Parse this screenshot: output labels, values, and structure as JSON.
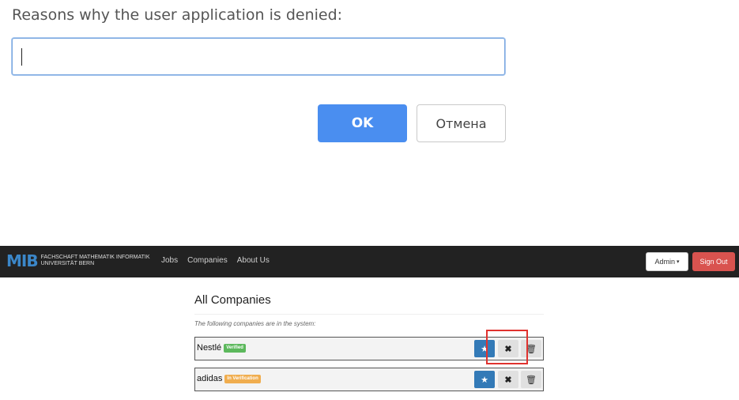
{
  "prompt": {
    "message": "Reasons why the user application is denied:",
    "input_value": "",
    "ok_label": "OK",
    "cancel_label": "Отмена"
  },
  "navbar": {
    "logo_mark": "MIB",
    "logo_line1": "FACHSCHAFT MATHEMATIK INFORMATIK",
    "logo_line2": "UNIVERSITÄT BERN",
    "links": [
      "Jobs",
      "Companies",
      "About Us"
    ],
    "admin_label": "Admin",
    "signout_label": "Sign Out"
  },
  "main": {
    "title": "All Companies",
    "subtitle": "The following companies are in the system:",
    "companies": [
      {
        "name": "Nestlé",
        "status": "Verified"
      },
      {
        "name": "adidas",
        "status": "In Verification"
      }
    ]
  },
  "icons": {
    "star": "★",
    "remove": "✖",
    "trash": "🗑"
  },
  "colors": {
    "ok_button": "#4a8ef0",
    "navbar": "#222222",
    "signout": "#d9534f",
    "star_button": "#337ab7",
    "verified": "#5cb85c",
    "in_verification": "#f0ad4e",
    "highlight": "#e0322f"
  }
}
